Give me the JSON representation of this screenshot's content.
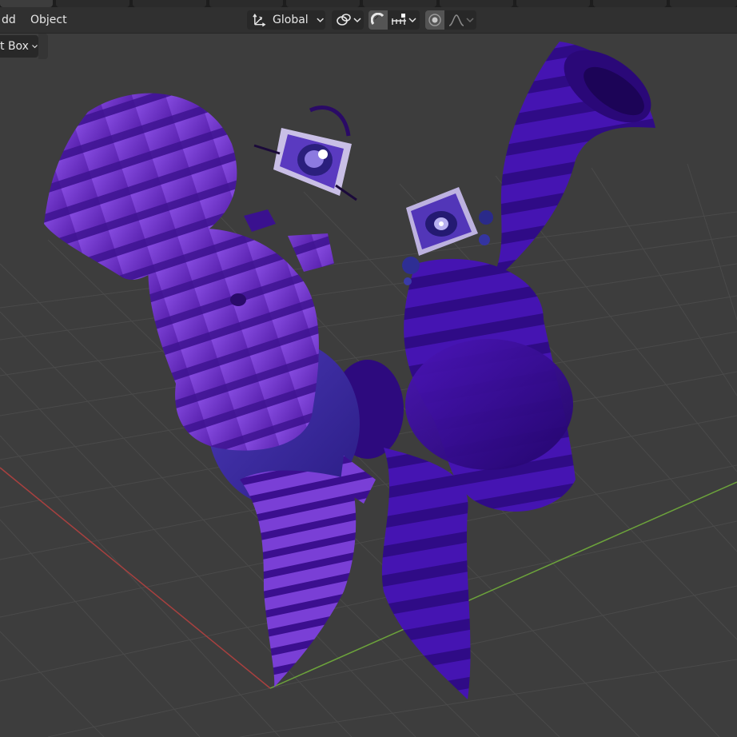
{
  "header": {
    "menu": [
      {
        "label": "dd"
      },
      {
        "label": "Object"
      }
    ],
    "transform_orientation": {
      "label": "Global",
      "icon": "transform-orientation-icon"
    },
    "pivot": {
      "icon": "pivot-link-icon"
    },
    "snapping": {
      "icon": "magnet-icon",
      "active": true
    },
    "snap_target": {
      "icon": "snap-increment-icon"
    },
    "proportional_editing": {
      "icon": "proportional-editing-icon"
    },
    "falloff": {
      "icon": "falloff-curve-icon"
    }
  },
  "toolbar": {
    "select_mode": {
      "label": "t Box"
    }
  },
  "viewport": {
    "background": "#3d3d3d",
    "grid_color": "#4a4a4a",
    "x_axis_color": "#a8403f",
    "y_axis_color": "#6ca33b",
    "model_colors": {
      "light_purple": "#7a3fd6",
      "mid_purple": "#5a22b0",
      "dark_purple": "#2d0877",
      "stripe_dark": "#3a0f8c",
      "blue_body": "#3a2a9c"
    }
  }
}
